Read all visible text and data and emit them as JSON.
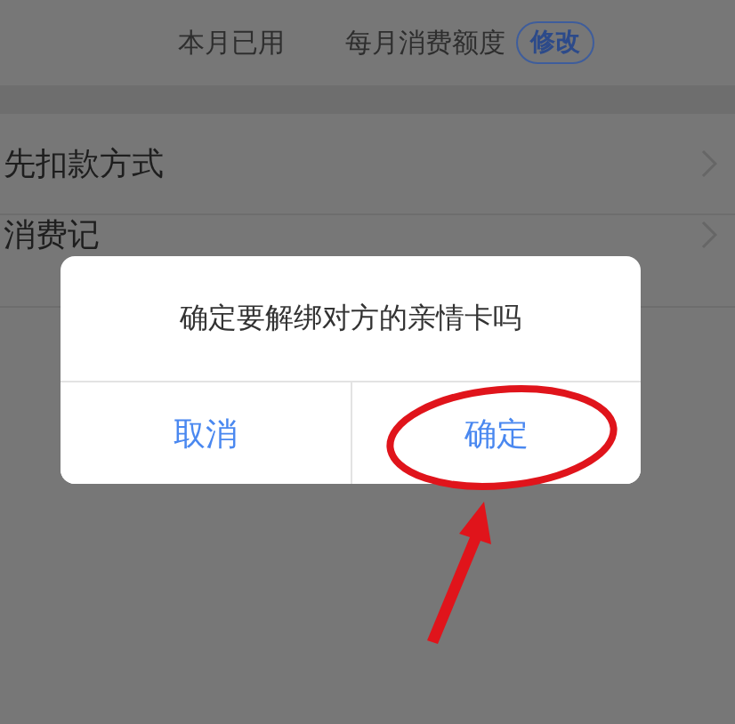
{
  "summary": {
    "labels": [
      "本月已用",
      "每月消费额度"
    ],
    "edit_button": "修改"
  },
  "rows": [
    {
      "label": "先扣款方式"
    },
    {
      "label": "消费记"
    }
  ],
  "dialog": {
    "message": "确定要解绑对方的亲情卡吗",
    "buttons": [
      {
        "label": "取消"
      },
      {
        "label": "确定"
      }
    ]
  }
}
